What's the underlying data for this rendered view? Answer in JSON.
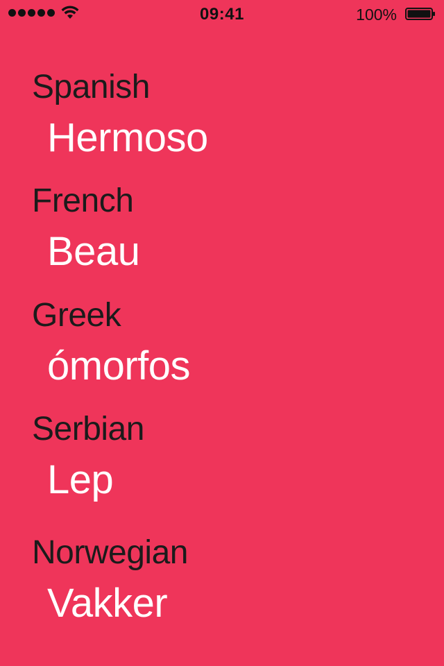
{
  "status_bar": {
    "time": "09:41",
    "battery_percent": "100%",
    "signal_bars": 5,
    "icons": [
      "signal-dots-icon",
      "wifi-icon",
      "battery-icon"
    ]
  },
  "colors": {
    "background": "#ef355a",
    "language_name": "#1b1b1b",
    "translation": "#ffffff"
  },
  "translations": [
    {
      "language": "Spanish",
      "word": "Hermoso"
    },
    {
      "language": "French",
      "word": "Beau"
    },
    {
      "language": "Greek",
      "word": "ómorfos"
    },
    {
      "language": "Serbian",
      "word": "Lep"
    },
    {
      "language": "Norwegian",
      "word": "Vakker"
    }
  ]
}
